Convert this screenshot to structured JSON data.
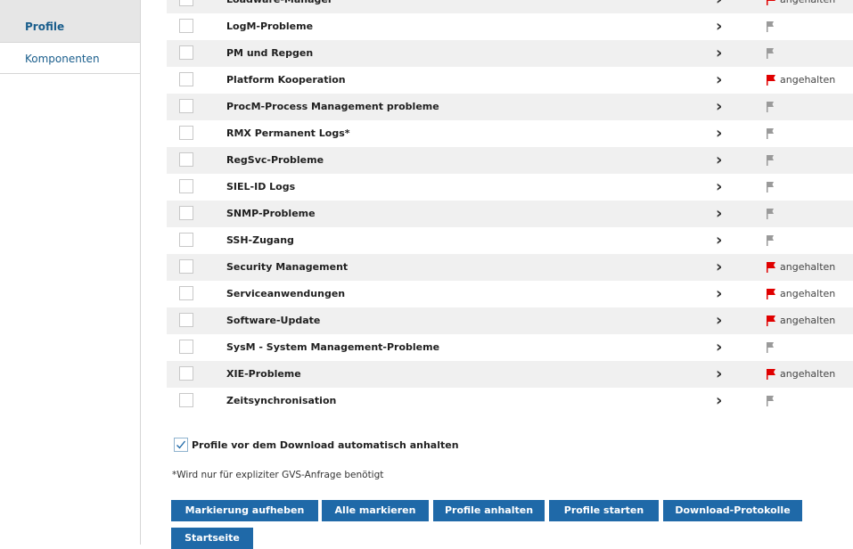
{
  "sidebar": {
    "items": [
      {
        "label": "Profile"
      },
      {
        "label": "Komponenten"
      }
    ]
  },
  "colors": {
    "accent": "#1f69a8",
    "flag_active": "#e00000",
    "flag_inactive": "#9a9a9a"
  },
  "rows": [
    {
      "name": "Loadware-Manager",
      "status": "angehalten",
      "flag": "red"
    },
    {
      "name": "LogM-Probleme",
      "status": "",
      "flag": "gray"
    },
    {
      "name": "PM und Repgen",
      "status": "",
      "flag": "gray"
    },
    {
      "name": "Platform Kooperation",
      "status": "angehalten",
      "flag": "red"
    },
    {
      "name": "ProcM-Process Management probleme",
      "status": "",
      "flag": "gray"
    },
    {
      "name": "RMX Permanent Logs*",
      "status": "",
      "flag": "gray"
    },
    {
      "name": "RegSvc-Probleme",
      "status": "",
      "flag": "gray"
    },
    {
      "name": "SIEL-ID Logs",
      "status": "",
      "flag": "gray"
    },
    {
      "name": "SNMP-Probleme",
      "status": "",
      "flag": "gray"
    },
    {
      "name": "SSH-Zugang",
      "status": "",
      "flag": "gray"
    },
    {
      "name": "Security Management",
      "status": "angehalten",
      "flag": "red"
    },
    {
      "name": "Serviceanwendungen",
      "status": "angehalten",
      "flag": "red"
    },
    {
      "name": "Software-Update",
      "status": "angehalten",
      "flag": "red"
    },
    {
      "name": "SysM - System Management-Probleme",
      "status": "",
      "flag": "gray"
    },
    {
      "name": "XIE-Probleme",
      "status": "angehalten",
      "flag": "red"
    },
    {
      "name": "Zeitsynchronisation",
      "status": "",
      "flag": "gray"
    }
  ],
  "auto_pause": {
    "label": "Profile vor dem Download automatisch anhalten",
    "checked": true
  },
  "note": "*Wird nur für expliziter GVS-Anfrage benötigt",
  "buttons": {
    "unmark": "Markierung aufheben",
    "mark_all": "Alle markieren",
    "pause": "Profile anhalten",
    "start": "Profile starten",
    "download": "Download-Protokolle",
    "home": "Startseite"
  }
}
